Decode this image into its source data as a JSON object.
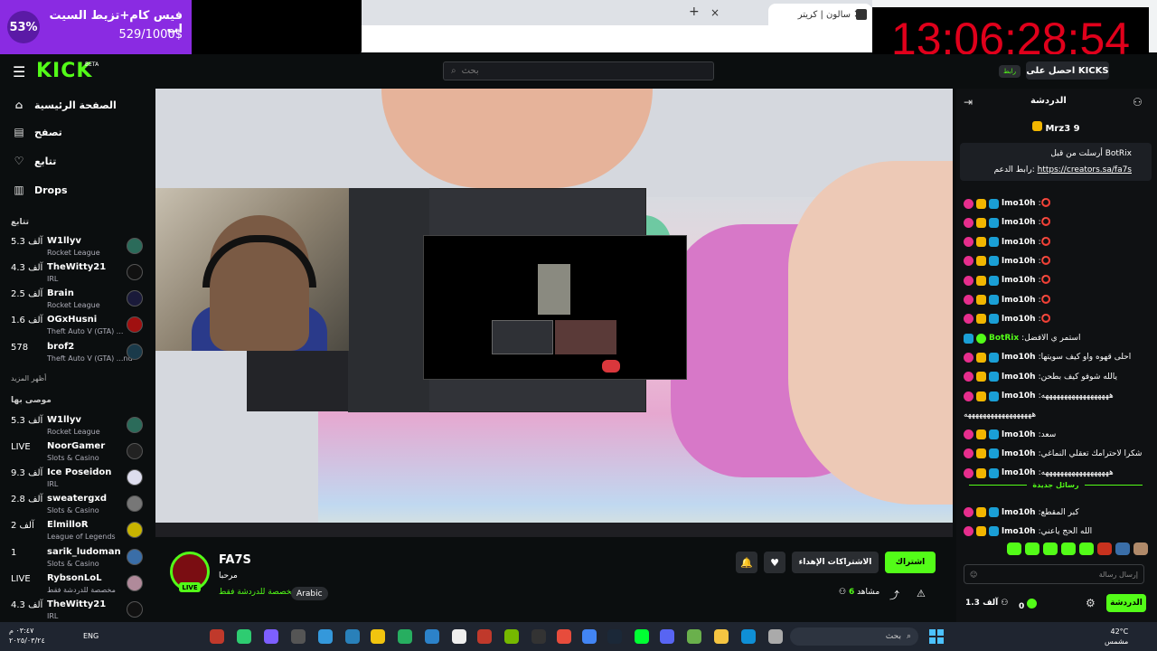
{
  "browser": {
    "tab_active_title": "سالون | كريتر",
    "tab_close": "×",
    "tab_new": "+"
  },
  "donation": {
    "percent": "53%",
    "title": "فيس كام+تزيط السيت اب",
    "progress": "529/1000$"
  },
  "clock": "13:06:28:54",
  "header": {
    "logo": "KICK",
    "logo_badge": "BETA",
    "search_placeholder": "بحث",
    "kicks_label": "احصل على KICKS",
    "kicks_bubble": "رابط"
  },
  "sidebar": {
    "nav": [
      {
        "label": "الصفحة الرئيسية",
        "icon": "⌂"
      },
      {
        "label": "تصفح",
        "icon": "▤"
      },
      {
        "label": "تتابع",
        "icon": "♡"
      },
      {
        "label": "Drops",
        "icon": "▥"
      }
    ],
    "following_title": "تتابع",
    "following": [
      {
        "name": "W1llyv",
        "cat": "Rocket League",
        "count": "5.3 آلف"
      },
      {
        "name": "TheWitty21",
        "cat": "IRL",
        "count": "4.3 آلف"
      },
      {
        "name": "Brain",
        "cat": "Rocket League",
        "count": "2.5 آلف"
      },
      {
        "name": "OGxHusni",
        "cat": "Theft Auto V (GTA) ...",
        "count": "1.6 آلف"
      },
      {
        "name": "brof2",
        "cat": "Theft Auto V (GTA) ...nd",
        "count": "578"
      }
    ],
    "show_more": "أظهر المزيد",
    "recommended_title": "موصى بها",
    "recommended": [
      {
        "name": "W1llyv",
        "cat": "Rocket League",
        "count": "5.3 آلف"
      },
      {
        "name": "NoorGamer",
        "cat": "Slots & Casino",
        "count": "LIVE"
      },
      {
        "name": "Ice Poseidon",
        "cat": "IRL",
        "count": "9.3 آلف"
      },
      {
        "name": "sweatergxd",
        "cat": "Slots & Casino",
        "count": "2.8 آلف"
      },
      {
        "name": "ElmilloR",
        "cat": "League of Legends",
        "count": "2 آلف"
      },
      {
        "name": "sarik_ludoman",
        "cat": "Slots & Casino",
        "count": "1"
      },
      {
        "name": "RybsonLoL",
        "cat": "مخصصة للدردشة فقط",
        "count": "LIVE"
      },
      {
        "name": "TheWitty21",
        "cat": "IRL",
        "count": "4.3 آلف"
      }
    ]
  },
  "chat": {
    "title": "الدردشة",
    "top_gifter": "Mrz3 9",
    "pinned_line1": "أرسلت من قبل BotRix",
    "pinned_line2_prefix": "رابط الدعم:",
    "pinned_link": "https://creators.sa/fa7s",
    "messages": [
      {
        "user": "lmo10h",
        "text": ":⭕"
      },
      {
        "user": "lmo10h",
        "text": ":⭕"
      },
      {
        "user": "lmo10h",
        "text": ":⭕"
      },
      {
        "user": "lmo10h",
        "text": ":⭕"
      },
      {
        "user": "lmo10h",
        "text": ":⭕"
      },
      {
        "user": "lmo10h",
        "text": ":⭕"
      },
      {
        "user": "lmo10h",
        "text": ":⭕"
      },
      {
        "user": "BotRix",
        "text": ":استمر ي الافضل"
      },
      {
        "user": "lmo10h",
        "text": ":احلى قهوه واو كيف سويتها"
      },
      {
        "user": "lmo10h",
        "text": ":يالله شوفو كيف بطحن"
      },
      {
        "user": "lmo10h",
        "text": ":ههههههههههههههههههه"
      },
      {
        "user": "",
        "text": "ههههههههههههههههههه"
      },
      {
        "user": "lmo10h",
        "text": ":سعد"
      },
      {
        "user": "lmo10h",
        "text": ":شكرا لاحترامك تعقلي النماغي"
      },
      {
        "user": "lmo10h",
        "text": ":ههههههههههههههههههه"
      },
      {
        "user": "lmo10h",
        "text": ":كبر المقطع"
      },
      {
        "user": "lmo10h",
        "text": ":الله الحج ياعني"
      }
    ],
    "new_messages": "رسائل جديدة",
    "input_placeholder": "إرسال رسالة",
    "send": "الدردشة",
    "kicks_count": "0",
    "viewers_small": "1.3 آلف"
  },
  "stream": {
    "streamer": "FA7S",
    "title": "مرحبا",
    "live": "LIVE",
    "language": "Arabic",
    "category": "مخصصة للدردشة فقط",
    "subscribe": "اشتراك",
    "gift_subs": "الاشتراكات الإهداء",
    "viewers_prefix": "مشاهد",
    "viewers_count": "6"
  },
  "taskbar": {
    "time": "٠٣:٤٧ م",
    "date": "٢٠٢٥/٠٣/٢٤",
    "lang": "ENG",
    "search": "بحث",
    "weather_temp": "42°C",
    "weather_desc": "مشمس"
  },
  "colors": {
    "brand_green": "#53fc18",
    "donation_purple": "#8a2be2",
    "clock_red": "#e0001b"
  }
}
